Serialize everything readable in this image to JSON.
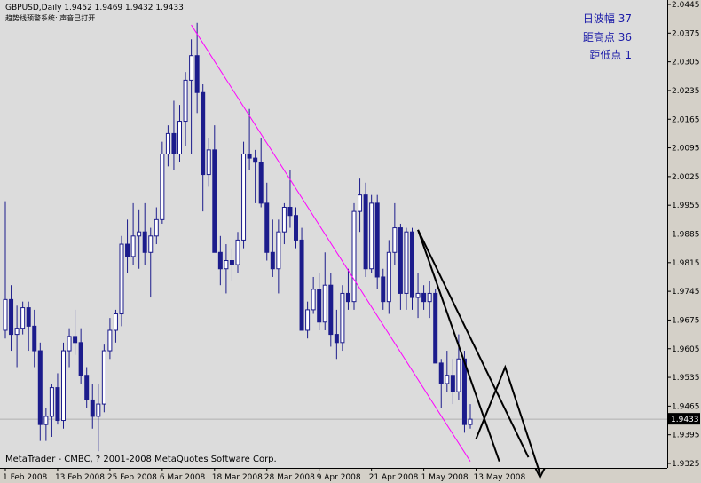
{
  "header": {
    "symbol_line": "GBPUSD,Daily  1.9452 1.9469 1.9432 1.9433",
    "note_line": "趋势线预警系统: 声音已打开"
  },
  "stats": {
    "line1": "日波幅 37",
    "line2": "距高点 36",
    "line3": "距低点 1"
  },
  "copyright": "MetaTrader - CMBC, ? 2001-2008 MetaQuotes Software Corp.",
  "current_price": "1.9433",
  "colors": {
    "background": "#dcdcdc",
    "candle": "#1c1c8c",
    "trendline": "#ff00ff",
    "projection": "#000000",
    "current_price_line": "#b0b0b0",
    "axis_text": "#000000",
    "stats_text": "#1a1aa8"
  },
  "chart_data": {
    "type": "candlestick",
    "y_ticks": [
      "2.0445",
      "2.0375",
      "2.0305",
      "2.0235",
      "2.0165",
      "2.0095",
      "2.0025",
      "1.9955",
      "1.9885",
      "1.9815",
      "1.9745",
      "1.9675",
      "1.9605",
      "1.9535",
      "1.9465",
      "1.9395",
      "1.9325"
    ],
    "ylim": [
      1.9325,
      2.0445
    ],
    "x_tick_labels": [
      "1 Feb 2008",
      "13 Feb 2008",
      "25 Feb 2008",
      "6 Mar 2008",
      "18 Mar 2008",
      "28 Mar 2008",
      "9 Apr 2008",
      "21 Apr 2008",
      "1 May 2008",
      "13 May 2008"
    ],
    "candles": [
      {
        "o": 1.965,
        "h": 1.9965,
        "l": 1.963,
        "c": 1.9725
      },
      {
        "o": 1.9725,
        "h": 1.976,
        "l": 1.96,
        "c": 1.964
      },
      {
        "o": 1.964,
        "h": 1.971,
        "l": 1.956,
        "c": 1.9655
      },
      {
        "o": 1.9655,
        "h": 1.972,
        "l": 1.964,
        "c": 1.9705
      },
      {
        "o": 1.9705,
        "h": 1.972,
        "l": 1.96,
        "c": 1.966
      },
      {
        "o": 1.966,
        "h": 1.97,
        "l": 1.956,
        "c": 1.96
      },
      {
        "o": 1.96,
        "h": 1.962,
        "l": 1.938,
        "c": 1.942
      },
      {
        "o": 1.942,
        "h": 1.946,
        "l": 1.938,
        "c": 1.944
      },
      {
        "o": 1.944,
        "h": 1.952,
        "l": 1.939,
        "c": 1.951
      },
      {
        "o": 1.951,
        "h": 1.9545,
        "l": 1.942,
        "c": 1.943
      },
      {
        "o": 1.943,
        "h": 1.962,
        "l": 1.941,
        "c": 1.96
      },
      {
        "o": 1.96,
        "h": 1.9655,
        "l": 1.956,
        "c": 1.9635
      },
      {
        "o": 1.9635,
        "h": 1.97,
        "l": 1.959,
        "c": 1.962
      },
      {
        "o": 1.962,
        "h": 1.9655,
        "l": 1.952,
        "c": 1.954
      },
      {
        "o": 1.954,
        "h": 1.956,
        "l": 1.946,
        "c": 1.948
      },
      {
        "o": 1.948,
        "h": 1.952,
        "l": 1.941,
        "c": 1.944
      },
      {
        "o": 1.944,
        "h": 1.952,
        "l": 1.9355,
        "c": 1.947
      },
      {
        "o": 1.947,
        "h": 1.9615,
        "l": 1.945,
        "c": 1.96
      },
      {
        "o": 1.96,
        "h": 1.968,
        "l": 1.958,
        "c": 1.965
      },
      {
        "o": 1.965,
        "h": 1.97,
        "l": 1.962,
        "c": 1.969
      },
      {
        "o": 1.969,
        "h": 1.988,
        "l": 1.966,
        "c": 1.986
      },
      {
        "o": 1.986,
        "h": 1.992,
        "l": 1.979,
        "c": 1.983
      },
      {
        "o": 1.983,
        "h": 1.996,
        "l": 1.981,
        "c": 1.988
      },
      {
        "o": 1.988,
        "h": 1.9945,
        "l": 1.98,
        "c": 1.989
      },
      {
        "o": 1.989,
        "h": 1.996,
        "l": 1.981,
        "c": 1.984
      },
      {
        "o": 1.984,
        "h": 1.99,
        "l": 1.973,
        "c": 1.988
      },
      {
        "o": 1.988,
        "h": 1.995,
        "l": 1.986,
        "c": 1.992
      },
      {
        "o": 1.992,
        "h": 2.011,
        "l": 1.991,
        "c": 2.008
      },
      {
        "o": 2.008,
        "h": 2.015,
        "l": 2.005,
        "c": 2.013
      },
      {
        "o": 2.013,
        "h": 2.021,
        "l": 2.004,
        "c": 2.008
      },
      {
        "o": 2.008,
        "h": 2.02,
        "l": 2.006,
        "c": 2.016
      },
      {
        "o": 2.016,
        "h": 2.028,
        "l": 2.01,
        "c": 2.026
      },
      {
        "o": 2.026,
        "h": 2.036,
        "l": 2.008,
        "c": 2.032
      },
      {
        "o": 2.032,
        "h": 2.04,
        "l": 2.018,
        "c": 2.023
      },
      {
        "o": 2.023,
        "h": 2.025,
        "l": 1.994,
        "c": 2.003
      },
      {
        "o": 2.003,
        "h": 2.012,
        "l": 2.0,
        "c": 2.009
      },
      {
        "o": 2.009,
        "h": 2.015,
        "l": 1.986,
        "c": 1.984
      },
      {
        "o": 1.984,
        "h": 1.988,
        "l": 1.976,
        "c": 1.98
      },
      {
        "o": 1.98,
        "h": 1.986,
        "l": 1.974,
        "c": 1.982
      },
      {
        "o": 1.982,
        "h": 1.985,
        "l": 1.977,
        "c": 1.981
      },
      {
        "o": 1.981,
        "h": 1.989,
        "l": 1.979,
        "c": 1.987
      },
      {
        "o": 1.987,
        "h": 2.011,
        "l": 1.985,
        "c": 2.008
      },
      {
        "o": 2.008,
        "h": 2.019,
        "l": 2.004,
        "c": 2.007
      },
      {
        "o": 2.007,
        "h": 2.009,
        "l": 1.996,
        "c": 2.006
      },
      {
        "o": 2.006,
        "h": 2.012,
        "l": 1.995,
        "c": 1.996
      },
      {
        "o": 1.996,
        "h": 2.001,
        "l": 1.982,
        "c": 1.984
      },
      {
        "o": 1.984,
        "h": 1.992,
        "l": 1.978,
        "c": 1.98
      },
      {
        "o": 1.98,
        "h": 1.992,
        "l": 1.974,
        "c": 1.989
      },
      {
        "o": 1.989,
        "h": 1.996,
        "l": 1.986,
        "c": 1.995
      },
      {
        "o": 1.995,
        "h": 2.004,
        "l": 1.99,
        "c": 1.993
      },
      {
        "o": 1.993,
        "h": 1.995,
        "l": 1.985,
        "c": 1.987
      },
      {
        "o": 1.987,
        "h": 1.99,
        "l": 1.977,
        "c": 1.965
      },
      {
        "o": 1.965,
        "h": 1.972,
        "l": 1.963,
        "c": 1.97
      },
      {
        "o": 1.97,
        "h": 1.978,
        "l": 1.969,
        "c": 1.975
      },
      {
        "o": 1.975,
        "h": 1.979,
        "l": 1.965,
        "c": 1.967
      },
      {
        "o": 1.967,
        "h": 1.984,
        "l": 1.965,
        "c": 1.976
      },
      {
        "o": 1.976,
        "h": 1.979,
        "l": 1.961,
        "c": 1.964
      },
      {
        "o": 1.964,
        "h": 1.97,
        "l": 1.958,
        "c": 1.962
      },
      {
        "o": 1.962,
        "h": 1.976,
        "l": 1.96,
        "c": 1.974
      },
      {
        "o": 1.974,
        "h": 1.98,
        "l": 1.97,
        "c": 1.972
      },
      {
        "o": 1.972,
        "h": 1.996,
        "l": 1.97,
        "c": 1.994
      },
      {
        "o": 1.994,
        "h": 2.002,
        "l": 1.989,
        "c": 1.998
      },
      {
        "o": 1.998,
        "h": 2.001,
        "l": 1.978,
        "c": 1.98
      },
      {
        "o": 1.98,
        "h": 1.998,
        "l": 1.979,
        "c": 1.996
      },
      {
        "o": 1.996,
        "h": 1.998,
        "l": 1.975,
        "c": 1.978
      },
      {
        "o": 1.978,
        "h": 1.98,
        "l": 1.97,
        "c": 1.972
      },
      {
        "o": 1.972,
        "h": 1.987,
        "l": 1.969,
        "c": 1.984
      },
      {
        "o": 1.984,
        "h": 1.996,
        "l": 1.981,
        "c": 1.99
      },
      {
        "o": 1.99,
        "h": 1.991,
        "l": 1.97,
        "c": 1.974
      },
      {
        "o": 1.974,
        "h": 1.99,
        "l": 1.97,
        "c": 1.989
      },
      {
        "o": 1.989,
        "h": 1.99,
        "l": 1.97,
        "c": 1.973
      },
      {
        "o": 1.973,
        "h": 1.979,
        "l": 1.968,
        "c": 1.974
      },
      {
        "o": 1.974,
        "h": 1.976,
        "l": 1.97,
        "c": 1.972
      },
      {
        "o": 1.972,
        "h": 1.977,
        "l": 1.968,
        "c": 1.974
      },
      {
        "o": 1.974,
        "h": 1.975,
        "l": 1.96,
        "c": 1.957
      },
      {
        "o": 1.957,
        "h": 1.958,
        "l": 1.946,
        "c": 1.952
      },
      {
        "o": 1.952,
        "h": 1.96,
        "l": 1.95,
        "c": 1.954
      },
      {
        "o": 1.954,
        "h": 1.958,
        "l": 1.947,
        "c": 1.95
      },
      {
        "o": 1.95,
        "h": 1.964,
        "l": 1.948,
        "c": 1.958
      },
      {
        "o": 1.958,
        "h": 1.96,
        "l": 1.94,
        "c": 1.942
      },
      {
        "o": 1.942,
        "h": 1.947,
        "l": 1.941,
        "c": 1.9433
      }
    ],
    "trendline": {
      "from": {
        "i": 32,
        "price": 2.0395
      },
      "to": {
        "i": 80,
        "price": 1.933
      }
    },
    "projections": [
      [
        {
          "i": 71,
          "price": 1.9895
        },
        {
          "i": 85,
          "price": 1.933
        }
      ],
      [
        {
          "i": 71,
          "price": 1.9895
        },
        {
          "i": 90,
          "price": 1.934
        }
      ],
      [
        {
          "i": 81,
          "price": 1.9385
        },
        {
          "i": 86,
          "price": 1.956
        },
        {
          "i": 92,
          "price": 1.93
        }
      ]
    ]
  }
}
